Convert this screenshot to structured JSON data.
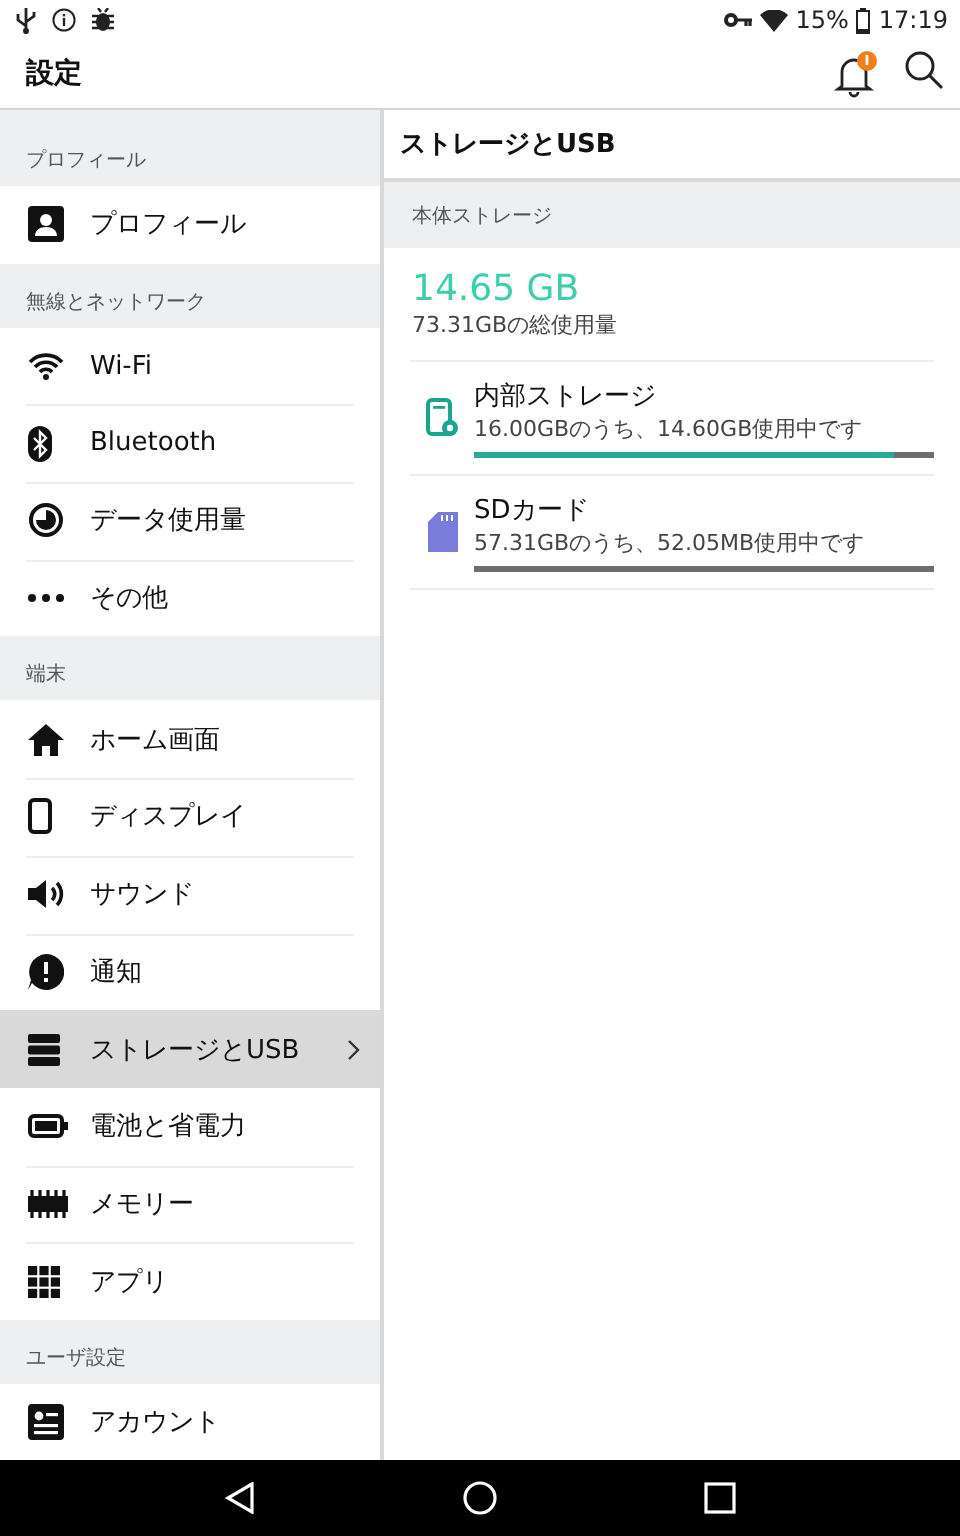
{
  "status_bar": {
    "battery": "15%",
    "time": "17:19"
  },
  "app_bar": {
    "title": "設定",
    "notification_badge": true
  },
  "sidebar": {
    "sections": [
      {
        "title": "プロフィール",
        "items": [
          {
            "label": "プロフィール",
            "kind": "person",
            "selected": false
          }
        ]
      },
      {
        "title": "無線とネットワーク",
        "items": [
          {
            "label": "Wi-Fi",
            "kind": "wifi",
            "selected": false
          },
          {
            "label": "Bluetooth",
            "kind": "bluetooth",
            "selected": false
          },
          {
            "label": "データ使用量",
            "kind": "data",
            "selected": false
          },
          {
            "label": "その他",
            "kind": "more",
            "selected": false
          }
        ]
      },
      {
        "title": "端末",
        "items": [
          {
            "label": "ホーム画面",
            "kind": "home",
            "selected": false
          },
          {
            "label": "ディスプレイ",
            "kind": "display",
            "selected": false
          },
          {
            "label": "サウンド",
            "kind": "sound",
            "selected": false
          },
          {
            "label": "通知",
            "kind": "notice",
            "selected": false
          },
          {
            "label": "ストレージとUSB",
            "kind": "storage",
            "selected": true
          },
          {
            "label": "電池と省電力",
            "kind": "battery",
            "selected": false
          },
          {
            "label": "メモリー",
            "kind": "memory",
            "selected": false
          },
          {
            "label": "アプリ",
            "kind": "apps",
            "selected": false
          }
        ]
      },
      {
        "title": "ユーザ設定",
        "items": [
          {
            "label": "アカウント",
            "kind": "account",
            "selected": false
          }
        ]
      }
    ]
  },
  "detail": {
    "title": "ストレージとUSB",
    "section": "本体ストレージ",
    "used": "14.65 GB",
    "total": "73.31GBの総使用量",
    "volumes": [
      {
        "name": "内部ストレージ",
        "usage": "16.00GBのうち、14.60GB使用中です",
        "kind": "phone",
        "level": 0.9125
      },
      {
        "name": "SDカード",
        "usage": "57.31GBのうち、52.05MB使用中です",
        "kind": "sdcard",
        "level": 0.001
      }
    ]
  }
}
